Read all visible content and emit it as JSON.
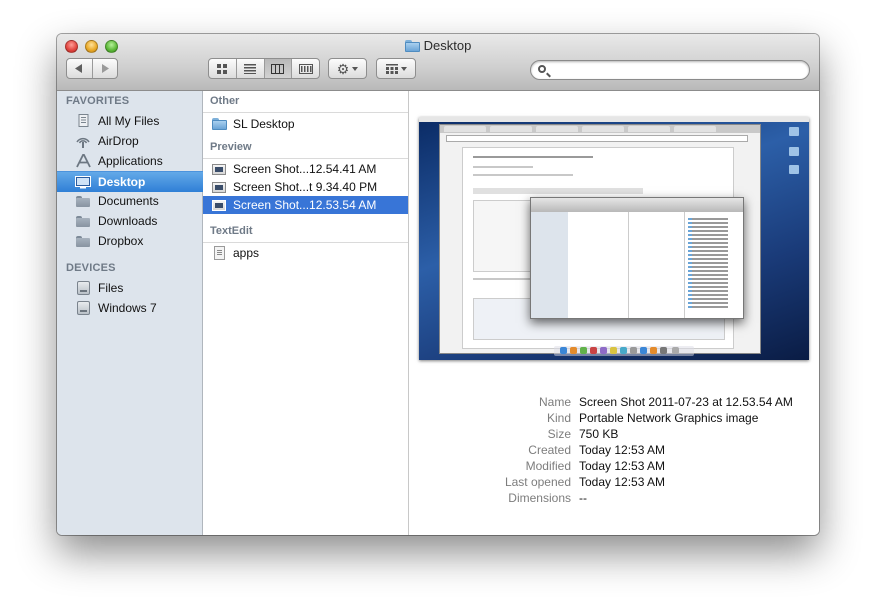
{
  "window": {
    "title": "Desktop"
  },
  "toolbar": {
    "back_icon": "back-arrow-icon",
    "forward_icon": "forward-arrow-icon",
    "views": [
      "icon-view",
      "list-view",
      "column-view",
      "coverflow-view"
    ],
    "active_view": "column-view",
    "action_icon": "gear-icon",
    "arrange_icon": "arrange-grid-icon",
    "search": {
      "value": "",
      "placeholder": ""
    }
  },
  "sidebar": {
    "favorites_header": "FAVORITES",
    "favorites": [
      {
        "label": "All My Files",
        "icon": "all-files-icon"
      },
      {
        "label": "AirDrop",
        "icon": "airdrop-icon"
      },
      {
        "label": "Applications",
        "icon": "applications-icon"
      },
      {
        "label": "Desktop",
        "icon": "desktop-icon",
        "selected": true
      },
      {
        "label": "Documents",
        "icon": "folder-icon"
      },
      {
        "label": "Downloads",
        "icon": "folder-icon"
      },
      {
        "label": "Dropbox",
        "icon": "folder-icon"
      }
    ],
    "devices_header": "DEVICES",
    "devices": [
      {
        "label": "Files",
        "icon": "disk-icon"
      },
      {
        "label": "Windows 7",
        "icon": "disk-icon"
      }
    ]
  },
  "column": {
    "groups": [
      {
        "header": "Other",
        "items": [
          "SL Desktop"
        ]
      },
      {
        "header": "Preview",
        "items": [
          "Screen Shot...12.54.41 AM",
          "Screen Shot...t 9.34.40 PM",
          "Screen Shot...12.53.54 AM"
        ]
      },
      {
        "header": "TextEdit",
        "items": [
          "apps"
        ]
      }
    ],
    "selected_item": "Screen Shot...12.53.54 AM"
  },
  "info": [
    {
      "label": "Name",
      "value": "Screen Shot 2011-07-23 at 12.53.54 AM"
    },
    {
      "label": "Kind",
      "value": "Portable Network Graphics image"
    },
    {
      "label": "Size",
      "value": "750 KB"
    },
    {
      "label": "Created",
      "value": "Today 12:53 AM"
    },
    {
      "label": "Modified",
      "value": "Today 12:53 AM"
    },
    {
      "label": "Last opened",
      "value": "Today 12:53 AM"
    },
    {
      "label": "Dimensions",
      "value": "--"
    }
  ],
  "colors": {
    "sidebar_bg": "#dde4ec",
    "selection_blue": "#3875d7",
    "sidebar_selection": "#2f7fd6"
  }
}
